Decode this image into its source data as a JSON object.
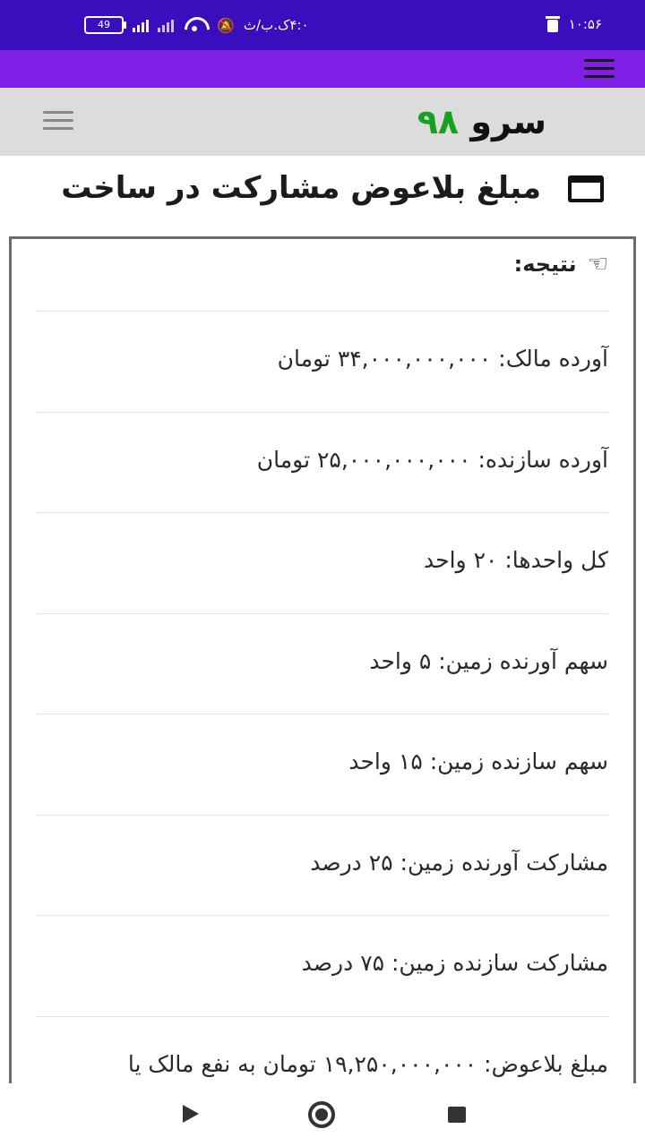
{
  "status_bar": {
    "battery": "49",
    "time_left": "۴:۰ک.ب/ث",
    "time_right": "۱۰:۵۶"
  },
  "site": {
    "logo_text": "سرو",
    "logo_number": "۹۸"
  },
  "page": {
    "title": "مبلغ بلاعوض مشارکت در ساخت"
  },
  "result": {
    "heading": "نتیجه:",
    "rows": [
      "آورده مالک: ۳۴,۰۰۰,۰۰۰,۰۰۰ تومان",
      "آورده سازنده: ۲۵,۰۰۰,۰۰۰,۰۰۰ تومان",
      "کل واحدها: ۲۰ واحد",
      "سهم آورنده زمین: ۵ واحد",
      "سهم سازنده زمین: ۱۵ واحد",
      "مشارکت آورنده زمین: ۲۵ درصد",
      "مشارکت سازنده زمین: ۷۵ درصد",
      "مبلغ بلاعوض: ۱۹,۲۵۰,۰۰۰,۰۰۰ تومان به نفع مالک یا"
    ]
  }
}
